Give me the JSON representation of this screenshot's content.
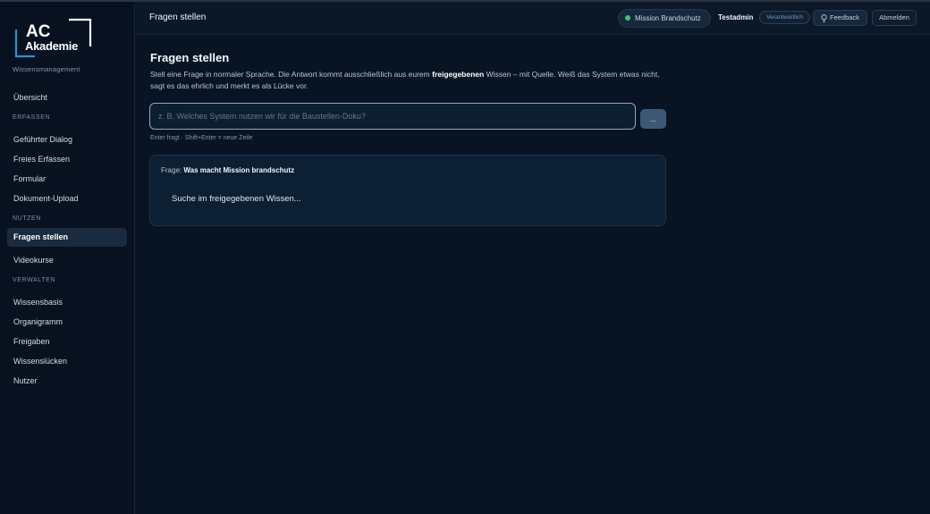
{
  "brand": {
    "logo_line1": "AC",
    "logo_line2": "Akademie",
    "subtitle": "Wissensmanagement"
  },
  "sidebar": {
    "overview": "Übersicht",
    "sections": [
      {
        "label": "ERFASSEN",
        "items": [
          "Geführter Dialog",
          "Freies Erfassen",
          "Formular",
          "Dokument-Upload"
        ]
      },
      {
        "label": "NUTZEN",
        "items": [
          "Fragen stellen",
          "Videokurse"
        ]
      },
      {
        "label": "VERWALTEN",
        "items": [
          "Wissensbasis",
          "Organigramm",
          "Freigaben",
          "Wissenslücken",
          "Nutzer"
        ]
      }
    ],
    "active_item": "Fragen stellen"
  },
  "header": {
    "title": "Fragen stellen",
    "mission": "Mission Brandschutz",
    "user": "Testadmin",
    "role": "Verantwortlich",
    "feedback": "Feedback",
    "logout": "Abmelden"
  },
  "main": {
    "title": "Fragen stellen",
    "intro_part1": "Stell eine Frage in normaler Sprache. Die Antwort kommt ausschließlich aus eurem ",
    "intro_bold": "freigegebenen",
    "intro_part2": " Wissen – mit Quelle. Weiß das System etwas nicht, sagt es das ehrlich und merkt es als Lücke vor.",
    "input_value": "",
    "input_placeholder": "z. B. Welches System nutzen wir für die Baustellen-Doku?",
    "send_label": "...",
    "hint": "Enter fragt · Shift+Enter = neue Zeile",
    "answer": {
      "question_prefix": "Frage:",
      "question": "Was macht Mission brandschutz",
      "status": "Suche im freigegebenen Wissen..."
    }
  },
  "colors": {
    "background": "#081424",
    "sidebar": "#07111f",
    "status_dot": "#34c77b",
    "accent_border": "#8fa7c2"
  }
}
